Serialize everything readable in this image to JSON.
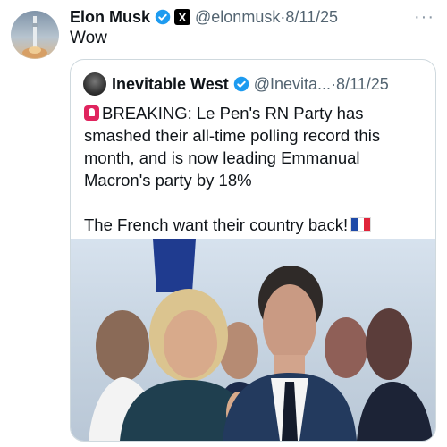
{
  "tweet": {
    "author_name": "Elon Musk",
    "author_handle": "@elonmusk",
    "separator": "·",
    "date": "8/11/25",
    "text": "Wow",
    "more_label": "···"
  },
  "quoted_tweet": {
    "author_name": "Inevitable West",
    "author_handle": "@Inevita...",
    "separator": "·",
    "date": "8/11/25",
    "text_line_1": "BREAKING: Le Pen's RN Party has smashed their all-time polling record this month, and is now leading Emmanual Macron's party by 18%",
    "text_line_2": "The French want their country back!"
  },
  "colors": {
    "verified": "#1d9bf0",
    "text": "#0f1419",
    "muted": "#536471"
  }
}
